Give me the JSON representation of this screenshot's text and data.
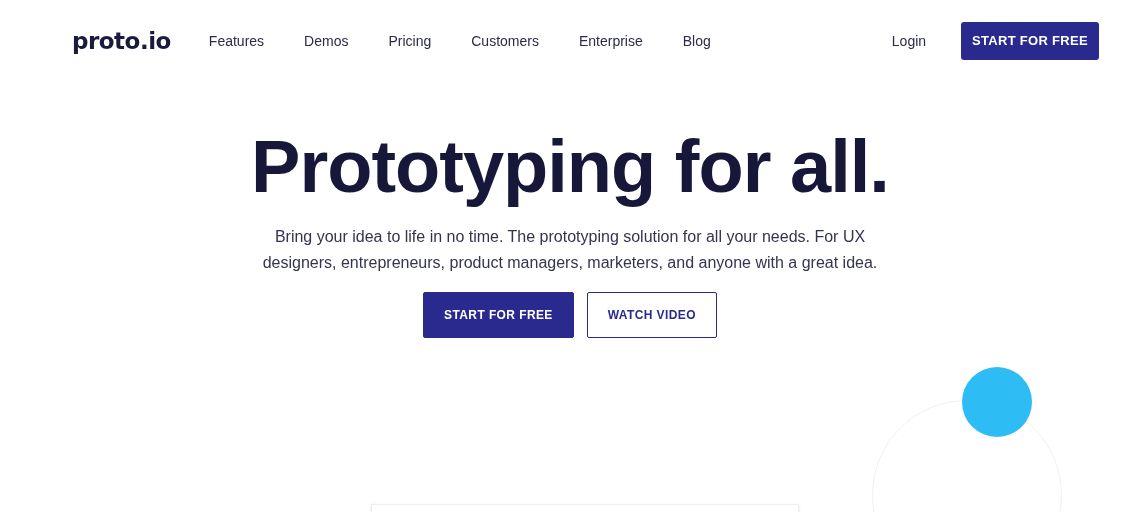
{
  "header": {
    "logo": "proto.io",
    "nav": [
      {
        "label": "Features"
      },
      {
        "label": "Demos"
      },
      {
        "label": "Pricing"
      },
      {
        "label": "Customers"
      },
      {
        "label": "Enterprise"
      },
      {
        "label": "Blog"
      }
    ],
    "login": "Login",
    "cta": "START FOR FREE"
  },
  "hero": {
    "title": "Prototyping for all.",
    "subtitle": "Bring your idea to life in no time. The prototyping solution for all your needs. For UX designers, entrepreneurs, product managers, marketers, and anyone with a great idea.",
    "buttons": [
      {
        "label": "START FOR FREE",
        "kind": "primary"
      },
      {
        "label": "WATCH VIDEO",
        "kind": "outline"
      }
    ]
  }
}
